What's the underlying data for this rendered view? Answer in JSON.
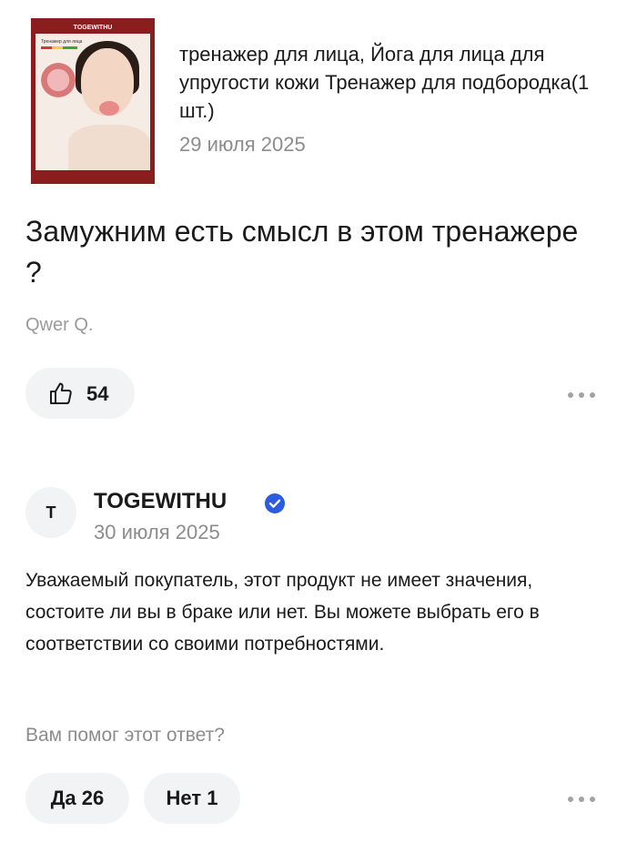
{
  "product": {
    "title": "тренажер для лица, Йога для лица для упругости кожи Тренажер для подбородка(1 шт.)",
    "date": "29 июля 2025",
    "thumb_brand": "TOGEWITHU",
    "thumb_caption": "Тренажер для лица"
  },
  "question": {
    "text": "Замужним есть смысл в этом тренажере ?",
    "author": "Qwer Q.",
    "likes": "54"
  },
  "answer": {
    "avatar_letter": "T",
    "seller": "TOGEWITHU",
    "date": "30 июля 2025",
    "text": "Уважаемый покупатель, этот продукт не имеет значения, состоите ли вы в браке или нет. Вы можете выбрать его в соответствии со своими потребностями.",
    "helpful_prompt": "Вам помог этот ответ?",
    "yes_label": "Да 26",
    "no_label": "Нет 1"
  },
  "colors": {
    "verified": "#2b5ce0",
    "pill_bg": "#f2f3f5",
    "muted": "#8c8c8c"
  },
  "icons": {
    "like": "thumbs-up-icon",
    "verified": "verified-check-icon",
    "more": "more-dots-icon"
  }
}
